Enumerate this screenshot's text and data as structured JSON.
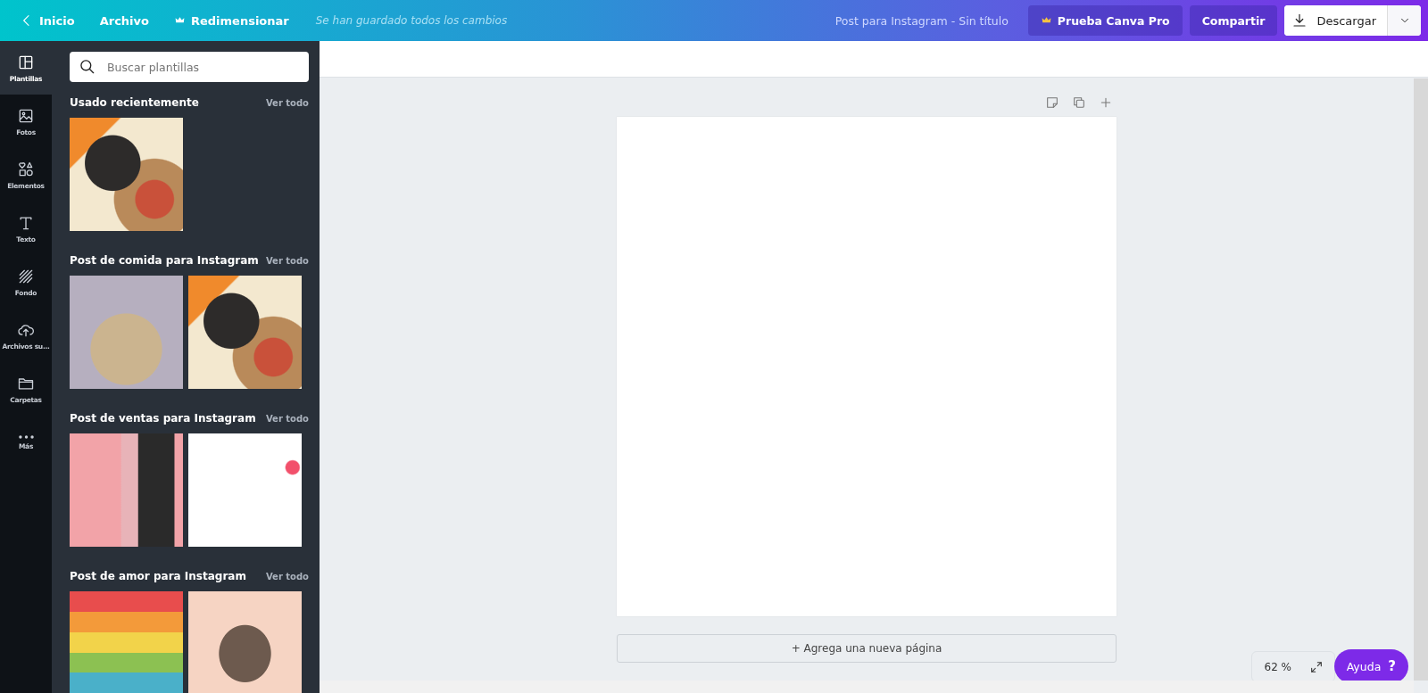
{
  "topbar": {
    "back": "Inicio",
    "menu": [
      "Archivo",
      "Redimensionar"
    ],
    "save_status": "Se han guardado todos los cambios",
    "title": "Post para Instagram - Sin título",
    "pro_button": "Prueba Canva Pro",
    "share_button": "Compartir",
    "download_button": "Descargar"
  },
  "rail": [
    {
      "kind": "templates",
      "label": "Plantillas",
      "selected": true
    },
    {
      "kind": "photos",
      "label": "Fotos",
      "selected": false
    },
    {
      "kind": "elements",
      "label": "Elementos",
      "selected": false
    },
    {
      "kind": "text",
      "label": "Texto",
      "selected": false
    },
    {
      "kind": "background",
      "label": "Fondo",
      "selected": false
    },
    {
      "kind": "uploads",
      "label": "Archivos su...",
      "selected": false
    },
    {
      "kind": "folders",
      "label": "Carpetas",
      "selected": false
    },
    {
      "kind": "more",
      "label": "Más",
      "selected": false
    }
  ],
  "search": {
    "placeholder": "Buscar plantillas"
  },
  "sections": [
    {
      "title": "Usado recientemente",
      "link": "Ver todo",
      "templates": [
        {
          "kind": "food"
        }
      ]
    },
    {
      "title": "Post de comida para Instagram",
      "link": "Ver todo",
      "templates": [
        {
          "kind": "dessert"
        },
        {
          "kind": "food"
        }
      ]
    },
    {
      "title": "Post de ventas para Instagram",
      "link": "Ver todo",
      "templates": [
        {
          "kind": "fashion"
        },
        {
          "kind": "sale"
        }
      ]
    },
    {
      "title": "Post de amor para Instagram",
      "link": "Ver todo",
      "templates": [
        {
          "kind": "rainbow"
        },
        {
          "kind": "couple"
        }
      ]
    }
  ],
  "canvas": {
    "add_page": "+ Agrega una nueva página",
    "zoom": "62 %",
    "help": "Ayuda",
    "help_icon": "?"
  }
}
